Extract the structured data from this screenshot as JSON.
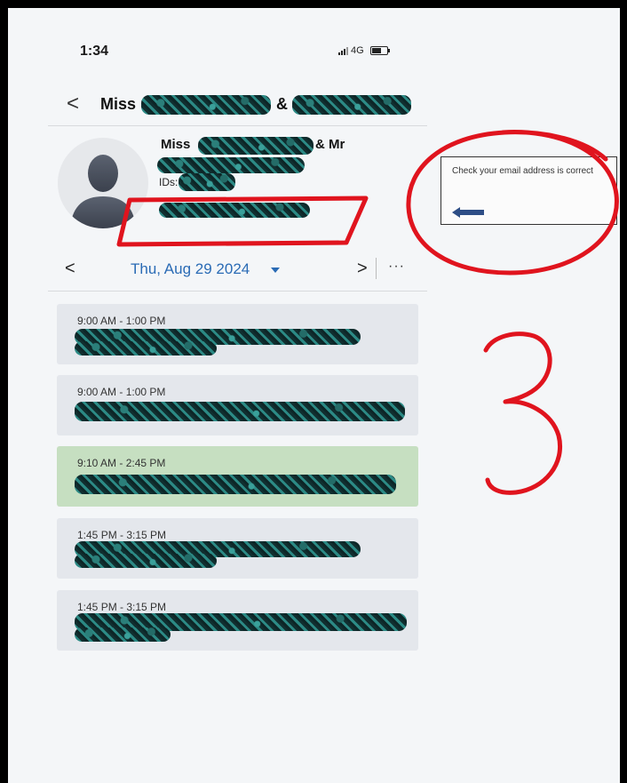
{
  "status_bar": {
    "time": "1:34",
    "network": "4G"
  },
  "header": {
    "back_glyph": "<",
    "title_prefix": "Miss",
    "title_amp": "&"
  },
  "profile": {
    "name_prefix": "Miss",
    "name_suffix": "& Mr",
    "ids_label": "IDs:"
  },
  "date_bar": {
    "prev_glyph": "<",
    "date": "Thu, Aug 29 2024",
    "next_glyph": ">",
    "more_glyph": "···"
  },
  "schedule": [
    {
      "time": "9:00 AM - 1:00 PM",
      "highlight": false
    },
    {
      "time": "9:00 AM - 1:00 PM",
      "highlight": false
    },
    {
      "time": "9:10 AM - 2:45 PM",
      "highlight": true
    },
    {
      "time": "1:45 PM - 3:15 PM",
      "highlight": false
    },
    {
      "time": "1:45 PM - 3:15 PM",
      "highlight": false
    }
  ],
  "annotation": {
    "callout_text": "Check your email address is correct",
    "step_number": "3",
    "annotation_color": "#e0141e",
    "arrow_color": "#2e4e86"
  },
  "colors": {
    "accent_blue": "#2a6bb5",
    "card_gray": "#e4e7ec",
    "card_green": "#c6dfc1"
  }
}
